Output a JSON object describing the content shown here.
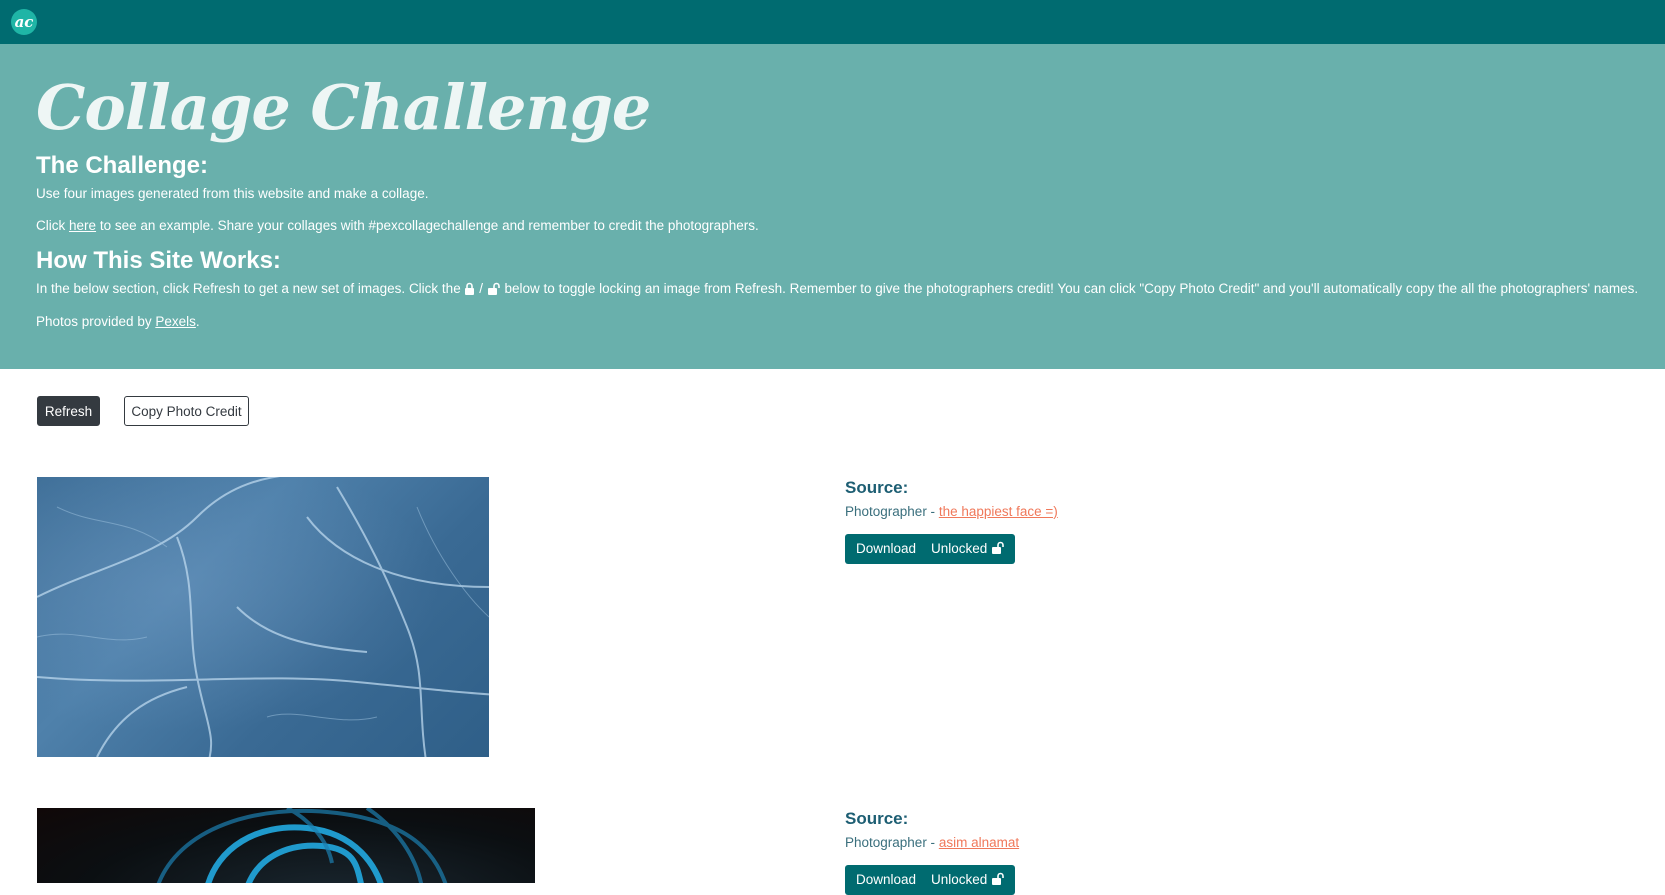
{
  "header": {
    "logo_text": "ac"
  },
  "hero": {
    "title": "Collage Challenge",
    "challenge_heading": "The Challenge:",
    "challenge_text": "Use four images generated from this website and make a collage.",
    "example_prefix": "Click",
    "example_link": "here",
    "example_suffix": "to see an example. Share your collages with #pexcollagechallenge and remember to credit the photographers.",
    "how_heading": "How This Site Works:",
    "how_text_part1": "In the below section, click Refresh to get a new set of images. Click the",
    "how_text_sep": "/",
    "how_text_part2": "below to toggle locking an image from Refresh. Remember to give the photographers credit! You can click \"Copy Photo Credit\" and you'll automatically copy the all the photographers' names.",
    "provided_prefix": "Photos provided by",
    "provided_link": "Pexels",
    "provided_suffix": "."
  },
  "controls": {
    "refresh_label": "Refresh",
    "copy_credit_label": "Copy Photo Credit"
  },
  "photos": [
    {
      "source_label": "Source:",
      "photographer_prefix": "Photographer -",
      "photographer_name": "the happiest face =)",
      "download_label": "Download",
      "lock_label": "Unlocked"
    },
    {
      "source_label": "Source:",
      "photographer_prefix": "Photographer -",
      "photographer_name": "asim alnamat",
      "download_label": "Download",
      "lock_label": "Unlocked"
    }
  ],
  "colors": {
    "topbar": "#006b70",
    "hero_bg": "#69b0ac",
    "accent_link": "#f0785a",
    "button_dark": "#343a40"
  }
}
